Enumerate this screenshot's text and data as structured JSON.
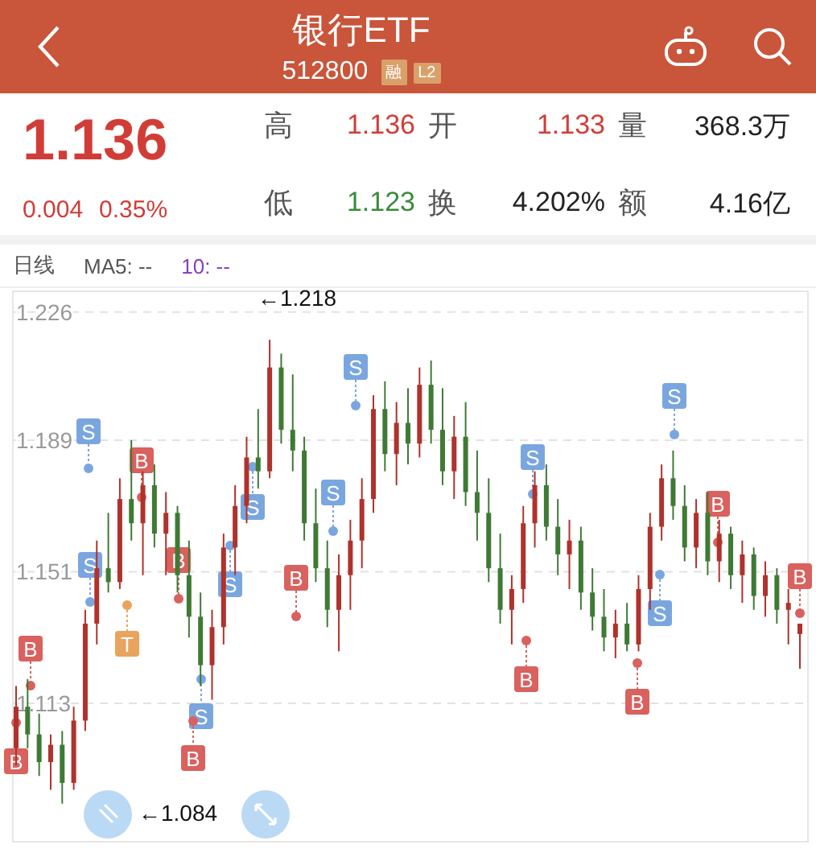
{
  "header": {
    "title": "银行ETF",
    "code": "512800",
    "badges": [
      "融",
      "L2"
    ]
  },
  "quote": {
    "price": "1.136",
    "change": "0.004",
    "change_pct": "0.35%"
  },
  "stats": [
    {
      "label": "高",
      "value": "1.136",
      "color": "#d23c37"
    },
    {
      "label": "开",
      "value": "1.133",
      "color": "#d23c37"
    },
    {
      "label": "量",
      "value": "368.3万",
      "color": "#222222"
    },
    {
      "label": "低",
      "value": "1.123",
      "color": "#3b8a3c"
    },
    {
      "label": "换",
      "value": "4.202%",
      "color": "#222222"
    },
    {
      "label": "额",
      "value": "4.16亿",
      "color": "#222222"
    }
  ],
  "legend": {
    "period": "日线",
    "ma5": "MA5: --",
    "ma10": "10: --"
  },
  "chart": {
    "chart_data": {
      "type": "candlestick",
      "grid": true,
      "ylim": [
        1.073,
        1.232
      ],
      "yticks": [
        {
          "value": 1.226,
          "label": "1.226"
        },
        {
          "value": 1.189,
          "label": "1.189"
        },
        {
          "value": 1.151,
          "label": "1.151"
        },
        {
          "value": 1.113,
          "label": "1.113"
        }
      ],
      "ohlc": [
        [
          1.1,
          1.118,
          1.095,
          1.112
        ],
        [
          1.112,
          1.12,
          1.1,
          1.104
        ],
        [
          1.104,
          1.11,
          1.092,
          1.096
        ],
        [
          1.096,
          1.104,
          1.088,
          1.101
        ],
        [
          1.101,
          1.105,
          1.084,
          1.09
        ],
        [
          1.09,
          1.112,
          1.088,
          1.108
        ],
        [
          1.108,
          1.14,
          1.105,
          1.136
        ],
        [
          1.136,
          1.16,
          1.13,
          1.152
        ],
        [
          1.152,
          1.168,
          1.145,
          1.148
        ],
        [
          1.148,
          1.178,
          1.146,
          1.172
        ],
        [
          1.172,
          1.189,
          1.16,
          1.165
        ],
        [
          1.165,
          1.18,
          1.15,
          1.176
        ],
        [
          1.176,
          1.182,
          1.158,
          1.162
        ],
        [
          1.162,
          1.174,
          1.15,
          1.168
        ],
        [
          1.168,
          1.17,
          1.145,
          1.15
        ],
        [
          1.15,
          1.16,
          1.132,
          1.138
        ],
        [
          1.138,
          1.145,
          1.118,
          1.124
        ],
        [
          1.124,
          1.14,
          1.114,
          1.135
        ],
        [
          1.135,
          1.162,
          1.13,
          1.158
        ],
        [
          1.158,
          1.176,
          1.15,
          1.17
        ],
        [
          1.17,
          1.19,
          1.165,
          1.184
        ],
        [
          1.184,
          1.198,
          1.175,
          1.18
        ],
        [
          1.18,
          1.218,
          1.178,
          1.21
        ],
        [
          1.21,
          1.214,
          1.188,
          1.192
        ],
        [
          1.192,
          1.208,
          1.18,
          1.186
        ],
        [
          1.186,
          1.19,
          1.16,
          1.165
        ],
        [
          1.165,
          1.175,
          1.148,
          1.152
        ],
        [
          1.152,
          1.16,
          1.135,
          1.14
        ],
        [
          1.14,
          1.156,
          1.128,
          1.15
        ],
        [
          1.15,
          1.166,
          1.14,
          1.16
        ],
        [
          1.16,
          1.178,
          1.152,
          1.172
        ],
        [
          1.172,
          1.202,
          1.168,
          1.198
        ],
        [
          1.198,
          1.206,
          1.18,
          1.185
        ],
        [
          1.185,
          1.2,
          1.176,
          1.194
        ],
        [
          1.194,
          1.204,
          1.182,
          1.188
        ],
        [
          1.188,
          1.21,
          1.184,
          1.205
        ],
        [
          1.205,
          1.212,
          1.188,
          1.192
        ],
        [
          1.192,
          1.204,
          1.176,
          1.18
        ],
        [
          1.18,
          1.196,
          1.172,
          1.19
        ],
        [
          1.19,
          1.2,
          1.17,
          1.174
        ],
        [
          1.174,
          1.186,
          1.16,
          1.168
        ],
        [
          1.168,
          1.178,
          1.148,
          1.152
        ],
        [
          1.152,
          1.162,
          1.136,
          1.14
        ],
        [
          1.14,
          1.15,
          1.13,
          1.146
        ],
        [
          1.146,
          1.17,
          1.142,
          1.165
        ],
        [
          1.165,
          1.18,
          1.158,
          1.176
        ],
        [
          1.176,
          1.182,
          1.16,
          1.164
        ],
        [
          1.164,
          1.172,
          1.15,
          1.156
        ],
        [
          1.156,
          1.166,
          1.146,
          1.16
        ],
        [
          1.16,
          1.164,
          1.14,
          1.145
        ],
        [
          1.145,
          1.152,
          1.134,
          1.138
        ],
        [
          1.138,
          1.146,
          1.128,
          1.132
        ],
        [
          1.132,
          1.14,
          1.126,
          1.136
        ],
        [
          1.136,
          1.142,
          1.128,
          1.13
        ],
        [
          1.13,
          1.15,
          1.128,
          1.146
        ],
        [
          1.146,
          1.168,
          1.14,
          1.164
        ],
        [
          1.164,
          1.182,
          1.16,
          1.178
        ],
        [
          1.178,
          1.186,
          1.166,
          1.17
        ],
        [
          1.17,
          1.176,
          1.154,
          1.158
        ],
        [
          1.158,
          1.172,
          1.152,
          1.168
        ],
        [
          1.168,
          1.174,
          1.15,
          1.154
        ],
        [
          1.154,
          1.166,
          1.148,
          1.162
        ],
        [
          1.162,
          1.164,
          1.146,
          1.15
        ],
        [
          1.15,
          1.16,
          1.142,
          1.156
        ],
        [
          1.156,
          1.158,
          1.14,
          1.144
        ],
        [
          1.144,
          1.154,
          1.138,
          1.15
        ],
        [
          1.15,
          1.152,
          1.136,
          1.14
        ],
        [
          1.14,
          1.146,
          1.13,
          1.142
        ],
        [
          1.133,
          1.136,
          1.123,
          1.136
        ]
      ]
    },
    "high_label": "←1.218",
    "low_label": "←1.084",
    "markers": [
      {
        "kind": "sell",
        "text": "S"
      },
      {
        "kind": "buy",
        "text": "B"
      },
      {
        "kind": "sell",
        "text": "S"
      },
      {
        "kind": "sell",
        "text": "S"
      },
      {
        "kind": "sell",
        "text": "S"
      },
      {
        "kind": "sell",
        "text": "S"
      },
      {
        "kind": "sell",
        "text": "S"
      },
      {
        "kind": "sell",
        "text": "S"
      },
      {
        "kind": "buy",
        "text": "B"
      },
      {
        "kind": "sell",
        "text": "S"
      },
      {
        "kind": "hold",
        "text": "T"
      },
      {
        "kind": "buy",
        "text": "B"
      },
      {
        "kind": "buy",
        "text": "B"
      },
      {
        "kind": "sell",
        "text": "S"
      },
      {
        "kind": "buy",
        "text": "B"
      },
      {
        "kind": "buy",
        "text": "B"
      },
      {
        "kind": "buy",
        "text": "B"
      },
      {
        "kind": "buy",
        "text": "B"
      },
      {
        "kind": "buy",
        "text": "B"
      },
      {
        "kind": "sell",
        "text": "S"
      },
      {
        "kind": "buy",
        "text": "B"
      }
    ]
  }
}
